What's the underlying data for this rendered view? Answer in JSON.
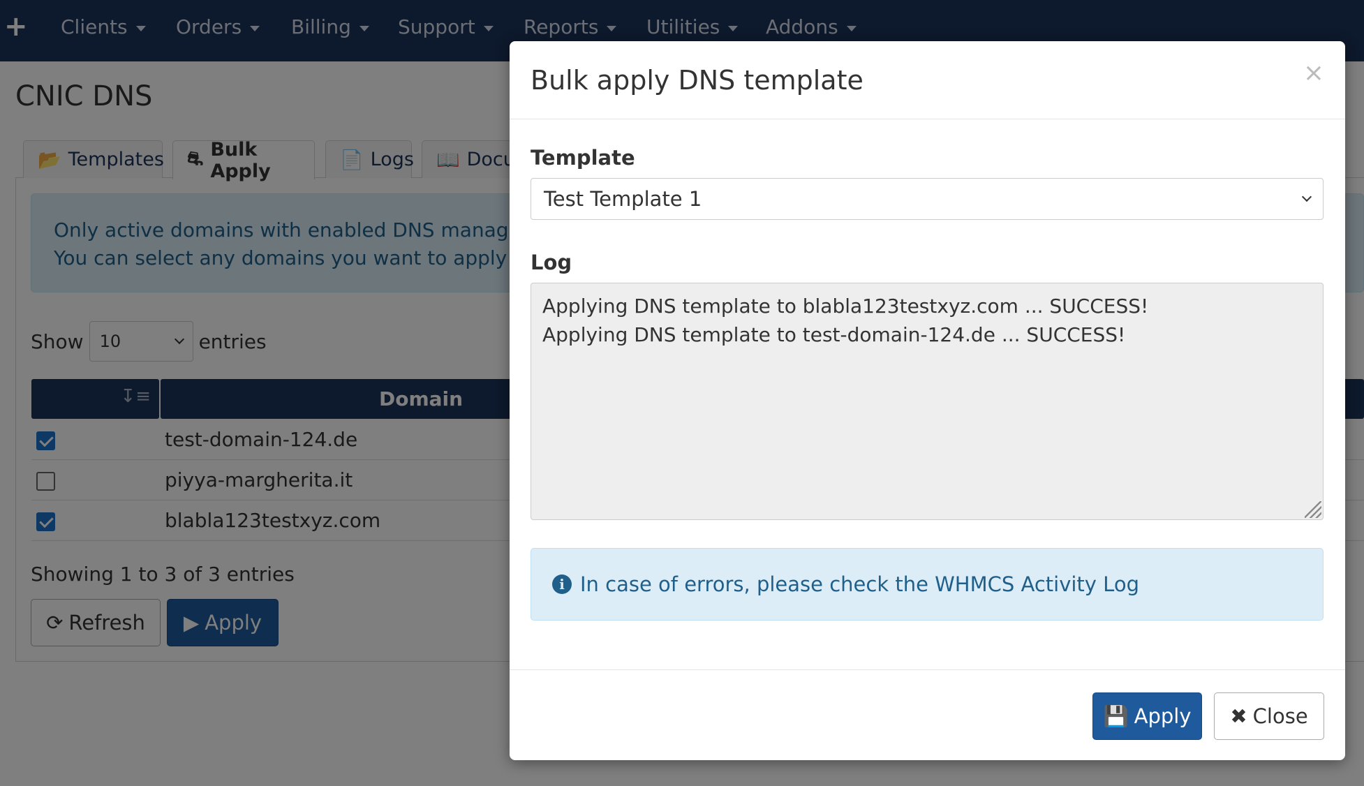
{
  "nav": {
    "plus_icon": "plus-icon",
    "items": [
      "Clients",
      "Orders",
      "Billing",
      "Support",
      "Reports",
      "Utilities",
      "Addons"
    ]
  },
  "page": {
    "title": "CNIC DNS",
    "tabs": [
      {
        "label": "Templates",
        "icon": "folder-open-icon"
      },
      {
        "label": "Bulk Apply",
        "icon": "paint-roller-icon"
      },
      {
        "label": "Logs",
        "icon": "file-icon"
      },
      {
        "label": "Docur",
        "icon": "book-icon"
      }
    ],
    "info_line1": "Only active domains with enabled DNS manageme",
    "info_line2": "You can select any domains you want to apply a te",
    "show_label": "Show",
    "entries_value": "10",
    "entries_label": "entries",
    "table": {
      "columns": [
        "",
        "Domain"
      ],
      "rows": [
        {
          "checked": true,
          "domain": "test-domain-124.de"
        },
        {
          "checked": false,
          "domain": "piyya-margherita.it"
        },
        {
          "checked": true,
          "domain": "blabla123testxyz.com"
        }
      ]
    },
    "showing_text": "Showing 1 to 3 of 3 entries",
    "refresh_label": "Refresh",
    "apply_label": "Apply"
  },
  "modal": {
    "title": "Bulk apply DNS template",
    "close_symbol": "×",
    "template_label": "Template",
    "template_value": "Test Template 1",
    "log_label": "Log",
    "log_lines": [
      "Applying DNS template to blabla123testxyz.com ... SUCCESS!",
      "Applying DNS template to test-domain-124.de ... SUCCESS!"
    ],
    "info_text": "In case of errors, please check the WHMCS Activity Log",
    "apply_label": "Apply",
    "close_label": "Close"
  },
  "colors": {
    "navbar": "#1a3359",
    "primary_button": "#1f5a9c",
    "info_background": "#dcedf8",
    "info_text": "#1f5f8a"
  }
}
